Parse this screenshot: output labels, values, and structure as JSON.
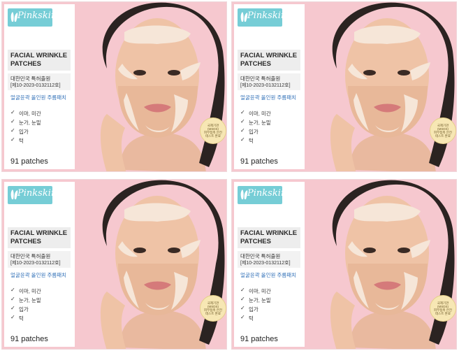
{
  "colors": {
    "background_pink": "#f6c8cf",
    "logo_teal": "#76cdd6",
    "tagline_blue": "#2f6fb7",
    "badge_gold": "#f7e7b4"
  },
  "cards": [
    {
      "brand": "Pinkskin",
      "title": "FACIAL WRINKLE PATCHES",
      "patent_line1": "대한민국 특허출원",
      "patent_line2": "[제10-2023-0132112호]",
      "tagline": "얼굴윤곽 올인원 주름패치",
      "areas": [
        "이마, 미간",
        "눈가, 눈밑",
        "입가",
        "턱"
      ],
      "count": "91 patches",
      "badge": [
        "국제기관",
        "(MSDS)",
        "피부접촉 안전",
        "테스트 완료"
      ]
    },
    {
      "brand": "Pinkskin",
      "title": "FACIAL WRINKLE PATCHES",
      "patent_line1": "대한민국 특허출원",
      "patent_line2": "[제10-2023-0132112호]",
      "tagline": "얼굴윤곽 올인원 주름패치",
      "areas": [
        "이마, 미간",
        "눈가, 눈밑",
        "입가",
        "턱"
      ],
      "count": "91 patches",
      "badge": [
        "국제기관",
        "(MSDS)",
        "피부접촉 안전",
        "테스트 완료"
      ]
    },
    {
      "brand": "Pinkskin",
      "title": "FACIAL WRINKLE PATCHES",
      "patent_line1": "대한민국 특허출원",
      "patent_line2": "[제10-2023-0132112호]",
      "tagline": "얼굴윤곽 올인원 주름패치",
      "areas": [
        "이마, 미간",
        "눈가, 눈밑",
        "입가",
        "턱"
      ],
      "count": "91 patches",
      "badge": [
        "국제기관",
        "(MSDS)",
        "피부접촉 안전",
        "테스트 완료"
      ]
    },
    {
      "brand": "Pinkskin",
      "title": "FACIAL WRINKLE PATCHES",
      "patent_line1": "대한민국 특허출원",
      "patent_line2": "[제10-2023-0132112호]",
      "tagline": "얼굴윤곽 올인원 주름패치",
      "areas": [
        "이마, 미간",
        "눈가, 눈밑",
        "입가",
        "턱"
      ],
      "count": "91 patches",
      "badge": [
        "국제기관",
        "(MSDS)",
        "피부접촉 안전",
        "테스트 완료"
      ]
    }
  ]
}
